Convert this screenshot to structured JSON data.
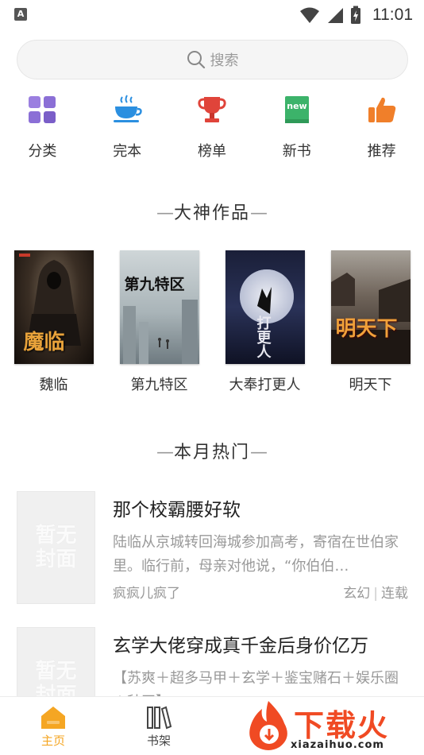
{
  "status_bar": {
    "time": "11:01",
    "app_icon_letter": "A"
  },
  "search": {
    "placeholder": "搜索"
  },
  "categories": [
    {
      "label": "分类",
      "icon": "grid-icon",
      "color": "#8b6fd6"
    },
    {
      "label": "完本",
      "icon": "coffee-cup-icon",
      "color": "#2b8fe0"
    },
    {
      "label": "榜单",
      "icon": "trophy-icon",
      "color": "#e0443a"
    },
    {
      "label": "新书",
      "icon": "new-book-icon",
      "color": "#3cb36a"
    },
    {
      "label": "推荐",
      "icon": "thumbs-up-icon",
      "color": "#f07f2a"
    }
  ],
  "sections": {
    "featured_title": "大神作品",
    "hot_title": "本月热门"
  },
  "featured_books": [
    {
      "name": "魏临",
      "cover_text": "魔临"
    },
    {
      "name": "第九特区",
      "cover_text": "第九特区"
    },
    {
      "name": "大奉打更人",
      "cover_text": "打更人"
    },
    {
      "name": "明天下",
      "cover_text": "明天下"
    }
  ],
  "hot_list": [
    {
      "title": "那个校霸腰好软",
      "description": "陆临从京城转回海城参加高考，寄宿在世伯家里。临行前，母亲对他说，“你伯伯…",
      "author": "疯疯儿疯了",
      "genre": "玄幻",
      "status": "连载",
      "cover_placeholder": "暂无封面"
    },
    {
      "title": "玄学大佬穿成真千金后身价亿万",
      "description": "【苏爽＋超多马甲＋玄学＋鉴宝赌石＋娱乐圈＋种田】",
      "author": "",
      "genre": "",
      "status": "",
      "cover_placeholder": "暂无封面"
    }
  ],
  "bottom_nav": {
    "home_label": "主页",
    "shelf_label": "书架",
    "active_color": "#f5a623"
  },
  "watermark": {
    "text": "下载火",
    "url": "xiazaihuo.com"
  }
}
